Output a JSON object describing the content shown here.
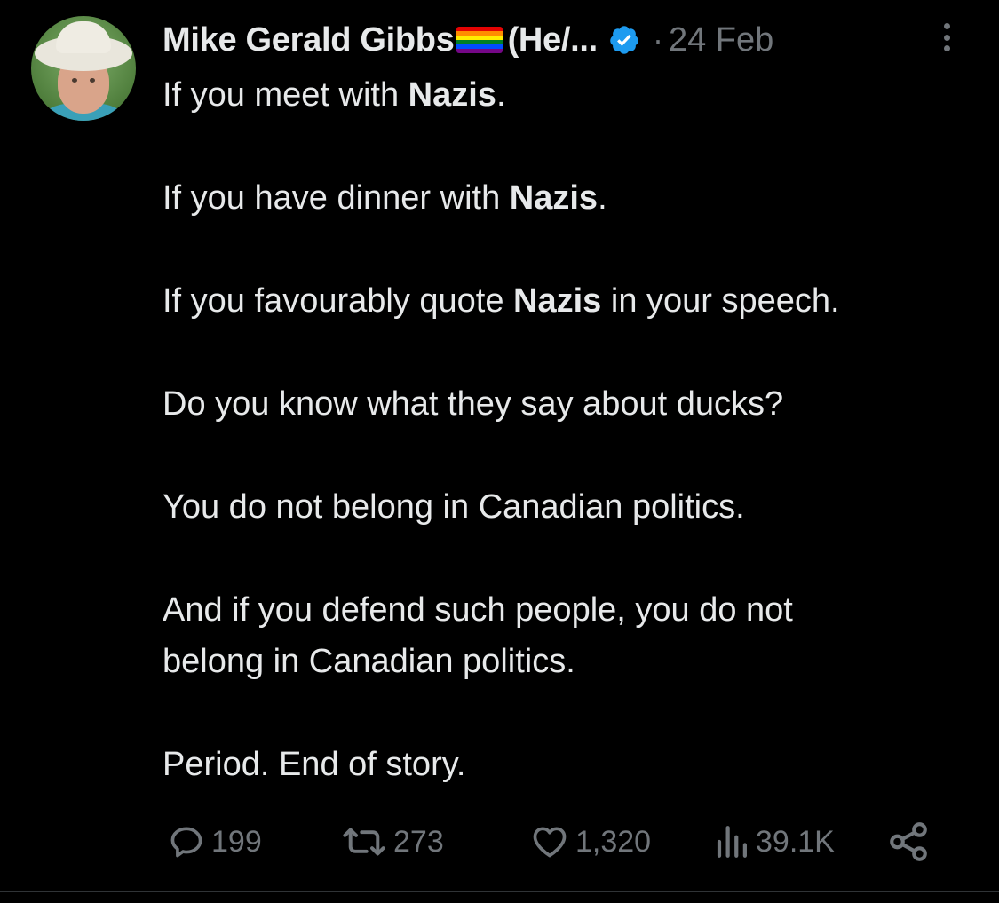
{
  "tweet": {
    "author": {
      "name": "Mike Gerald Gibbs",
      "name_suffix": "(He/...",
      "flag_icon": "rainbow-flag-icon",
      "verified_icon": "verified-badge-icon",
      "verified_color": "#1d9bf0"
    },
    "separator": "·",
    "date": "24 Feb",
    "more_icon": "more-vertical-icon",
    "lines": {
      "l1_pre": "If you meet with ",
      "l1_bold": "Nazis",
      "l1_post": ".",
      "l2_pre": "If you have dinner with ",
      "l2_bold": "Nazis",
      "l2_post": ".",
      "l3_pre": "If you favourably quote ",
      "l3_bold": "Nazis",
      "l3_post": " in your speech.",
      "l4": "Do you know what they say about ducks?",
      "l5": "You do not belong in Canadian politics.",
      "l6a": "And if you defend such people, you do not",
      "l6b": "belong in Canadian politics.",
      "l7": "Period. End of story."
    },
    "actions": {
      "replies": "199",
      "reposts": "273",
      "likes": "1,320",
      "views": "39.1K",
      "reply_icon": "reply-icon",
      "repost_icon": "repost-icon",
      "like_icon": "heart-icon",
      "views_icon": "views-chart-icon",
      "share_icon": "share-icon"
    },
    "colors": {
      "background": "#000000",
      "text": "#e7e9ea",
      "muted": "#71767b"
    }
  }
}
